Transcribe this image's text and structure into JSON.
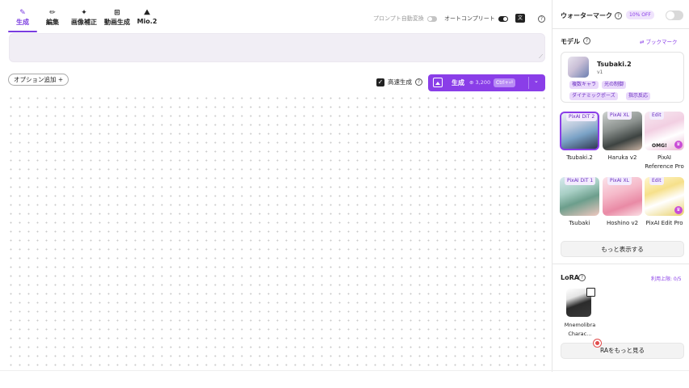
{
  "toolbar": {
    "tabs": [
      {
        "label": "生成",
        "icon": "pen-icon",
        "active": true
      },
      {
        "label": "編集",
        "icon": "pencil-icon",
        "active": false
      },
      {
        "label": "画像補正",
        "icon": "sparkle-icon",
        "active": false
      },
      {
        "label": "動画生成",
        "icon": "video-add-icon",
        "active": false
      },
      {
        "label": "Mio.2",
        "icon": "mio-icon",
        "active": false
      }
    ],
    "auto_translate_label": "プロンプト自動変換",
    "auto_complete_label": "オートコンプリート"
  },
  "prompt": {
    "placeholder": ""
  },
  "options": {
    "add_option_label": "オプション追加 +"
  },
  "fast_gen": {
    "label": "高速生成",
    "checked": true
  },
  "generate": {
    "label": "生成",
    "cost": "⊕ 3,200",
    "shortcut": "Ctrl+⏎"
  },
  "watermark": {
    "title": "ウォーターマーク",
    "badge": "10% OFF",
    "enabled": false
  },
  "model": {
    "title": "モデル",
    "bookmark_label": "⇄ ブックマーク",
    "selected": {
      "name": "Tsubaki.2",
      "version": "v1",
      "tags": [
        "複数キャラ",
        "光の制御",
        "ダイナミックポーズ",
        "指示反応"
      ]
    },
    "tiles": [
      {
        "badge": "PixAI DiT 2",
        "caption": "Tsubaki.2",
        "selected": true
      },
      {
        "badge": "PixAI XL",
        "caption": "Haruka v2",
        "selected": false
      },
      {
        "badge": "Edit",
        "caption": "PixAI Reference Pro",
        "selected": false,
        "overlay": "OMG!",
        "premium": true
      },
      {
        "badge": "PixAI DiT 1",
        "caption": "Tsubaki",
        "selected": false
      },
      {
        "badge": "PixAI XL",
        "caption": "Hoshino v2",
        "selected": false
      },
      {
        "badge": "Edit",
        "caption": "PixAI Edit Pro",
        "selected": false,
        "premium": true
      }
    ],
    "more_label": "もっと表示する"
  },
  "lora": {
    "title": "LoRA",
    "limit": "利用上限: 0/5",
    "items": [
      {
        "name": "Mnemolibra Charac…"
      }
    ],
    "more_label": "RAをもっと見る"
  },
  "colors": {
    "accent": "#8a3ee8",
    "prompt_bg": "#f1eef5",
    "tag_bg": "#e9d8fb"
  }
}
